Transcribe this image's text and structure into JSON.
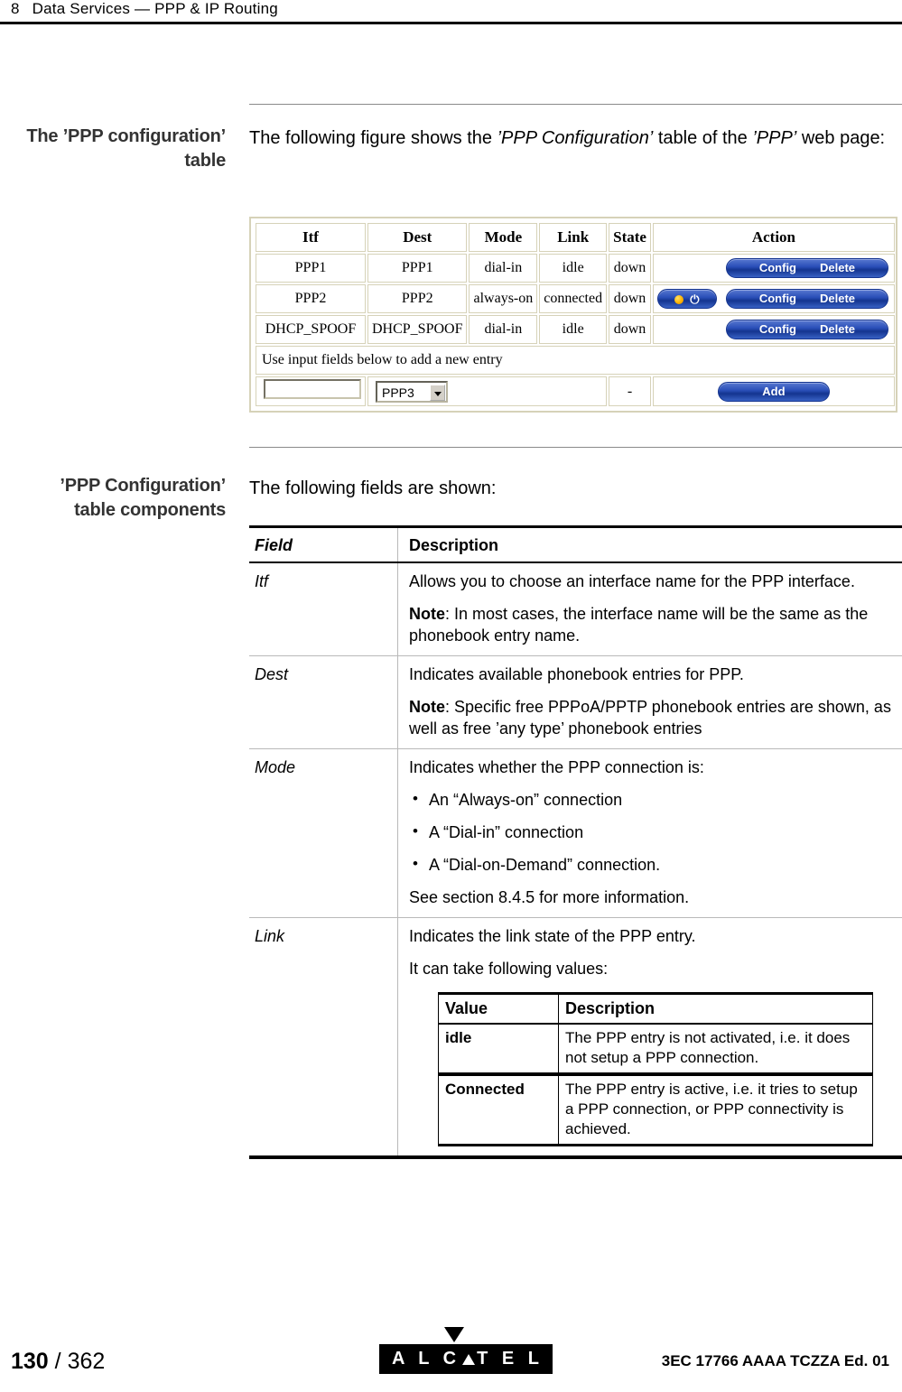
{
  "header": {
    "chapter_number": "8",
    "chapter_title": "Data Services — PPP & IP Routing"
  },
  "sections": [
    {
      "margin_heading_line1": "The ’PPP configuration’",
      "margin_heading_line2": "table",
      "intro_before_italic": "The following figure shows the ",
      "intro_italic1": "’PPP Configuration’",
      "intro_mid": " table of the ",
      "intro_italic2": "’PPP’",
      "intro_after": " web page:"
    },
    {
      "margin_heading_line1": "’PPP Configuration’",
      "margin_heading_line2": "table components",
      "intro": "The following fields are shown:"
    }
  ],
  "figure": {
    "columns": [
      "Itf",
      "Dest",
      "Mode",
      "Link",
      "State",
      "Action"
    ],
    "rows": [
      {
        "itf": "PPP1",
        "dest": "PPP1",
        "mode": "dial-in",
        "link": "idle",
        "state": "down",
        "has_power_toggle": false,
        "config_label": "Config",
        "delete_label": "Delete"
      },
      {
        "itf": "PPP2",
        "dest": "PPP2",
        "mode": "always-on",
        "link": "connected",
        "state": "down",
        "has_power_toggle": true,
        "config_label": "Config",
        "delete_label": "Delete"
      },
      {
        "itf": "DHCP_SPOOF",
        "dest": "DHCP_SPOOF",
        "mode": "dial-in",
        "link": "idle",
        "state": "down",
        "has_power_toggle": false,
        "config_label": "Config",
        "delete_label": "Delete"
      }
    ],
    "note_row": "Use input fields below to add a new entry",
    "add_row": {
      "itf_input_value": "",
      "dest_select_value": "PPP3",
      "state_value": "-",
      "add_label": "Add"
    },
    "accent_color": "#1f46b4",
    "border_color": "#d6d2b8",
    "led_color": "#ffb300"
  },
  "field_table": {
    "headers": [
      "Field",
      "Description"
    ],
    "rows": [
      {
        "field": "Itf",
        "paragraphs": [
          {
            "text": "Allows you to choose an interface name for the PPP interface."
          },
          {
            "note_label": "Note",
            "text": ": In most cases, the interface name will be the same as the phonebook entry name."
          }
        ]
      },
      {
        "field": "Dest",
        "paragraphs": [
          {
            "text": "Indicates available phonebook entries for PPP."
          },
          {
            "note_label": "Note",
            "text": ": Specific free PPPoA/PPTP phonebook entries are shown, as well as free ’any type’ phonebook entries"
          }
        ]
      },
      {
        "field": "Mode",
        "paragraphs": [
          {
            "text": "Indicates whether the PPP connection is:"
          }
        ],
        "bullets": [
          "An “Always-on” connection",
          "A “Dial-in” connection",
          "A “Dial-on-Demand” connection."
        ],
        "trailing_paragraphs": [
          "See section 8.4.5 for more information."
        ]
      },
      {
        "field": "Link",
        "paragraphs": [
          {
            "text": "Indicates the link state of the PPP entry."
          },
          {
            "text": "It can take following values:"
          }
        ],
        "nested_table": {
          "headers": [
            "Value",
            "Description"
          ],
          "rows": [
            {
              "value": "idle",
              "description": "The PPP entry is not activated, i.e. it does not setup a PPP connection."
            },
            {
              "value": "Connected",
              "description": "The PPP entry is active, i.e. it tries to setup a PPP connection, or PPP connectivity is achieved."
            }
          ]
        }
      }
    ]
  },
  "footer": {
    "page_current": "130",
    "page_separator": "/",
    "page_total": "362",
    "logo_left": "A L C",
    "logo_right": "T E L",
    "doc_reference": "3EC 17766 AAAA TCZZA Ed. 01"
  }
}
